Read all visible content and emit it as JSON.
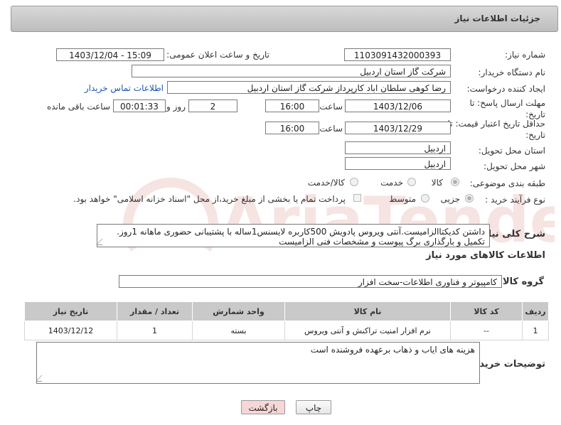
{
  "header": {
    "title": "جزئیات اطلاعات نیاز"
  },
  "fields": {
    "need_number_label": "شماره نیاز:",
    "need_number": "1103091432000393",
    "announce_label": "تاریخ و ساعت اعلان عمومی:",
    "announce_value": "1403/12/04 - 15:09",
    "buyer_org_label": "نام دستگاه خریدار:",
    "buyer_org": "شرکت گاز استان اردبیل",
    "creator_label": "ایجاد کننده درخواست:",
    "creator": "رضا کوهی سلطان اباد کارپرداز شرکت گاز استان اردبیل",
    "contact_link": "اطلاعات تماس خریدار",
    "deadline_label": "مهلت ارسال پاسخ: تا تاریخ:",
    "deadline_date": "1403/12/06",
    "time_label": "ساعت",
    "deadline_time": "16:00",
    "days_value": "2",
    "days_label": "روز و",
    "remaining_time": "00:01:33",
    "remaining_label": "ساعت باقی مانده",
    "validity_label": "حداقل تاریخ اعتبار قیمت: تا تاریخ:",
    "validity_date": "1403/12/29",
    "validity_time": "16:00",
    "province_label": "استان محل تحویل:",
    "province": "اردبیل",
    "city_label": "شهر محل تحویل:",
    "city": "اردبیل",
    "category_label": "طبقه بندی موضوعی:",
    "category_options": [
      "کالا",
      "خدمت",
      "کالا/خدمت"
    ],
    "process_label": "نوع فرآیند خرید :",
    "process_options": [
      "جزیی",
      "متوسط"
    ],
    "payment_note": "پرداخت تمام یا بخشی از مبلغ خرید،از محل \"اسناد خزانه اسلامی\" خواهد بود.",
    "description_label": "شرح کلی نیاز:",
    "description_line1": "داشتن کدیکتاالزامیست.آنتی ویروس پادویش 500کاربره لایسنس1ساله با پشتیبانی حضوری ماهانه 1روز.",
    "description_line2": "تکمیل و بارگذاری برگ پیوست و مشخصات فنی الزامیست",
    "goods_info_title": "اطلاعات کالاهای مورد نیاز",
    "goods_group_label": "گروه کالا:",
    "goods_group": "کامپیوتر و فناوری اطلاعات-سخت افزار",
    "buyer_notes_label": "توضیحات خریدار:",
    "buyer_notes": "هزینه های ایاب و ذهاب برعهده فروشنده است"
  },
  "table": {
    "headers": [
      "ردیف",
      "کد کالا",
      "نام کالا",
      "واحد شمارش",
      "تعداد / مقدار",
      "تاریخ نیاز"
    ],
    "rows": [
      [
        "1",
        "--",
        "نرم افزار امنیت تراکنش و آنتی ویروس",
        "بسته",
        "1",
        "1403/12/12"
      ]
    ]
  },
  "buttons": {
    "print": "چاپ",
    "back": "بازگشت"
  },
  "watermark": {
    "text": "AriaTender.net"
  },
  "colors": {
    "link": "#1a57b5",
    "back_button_bg": "#f6d6d6",
    "header_gradient": "#c8c8c8"
  }
}
